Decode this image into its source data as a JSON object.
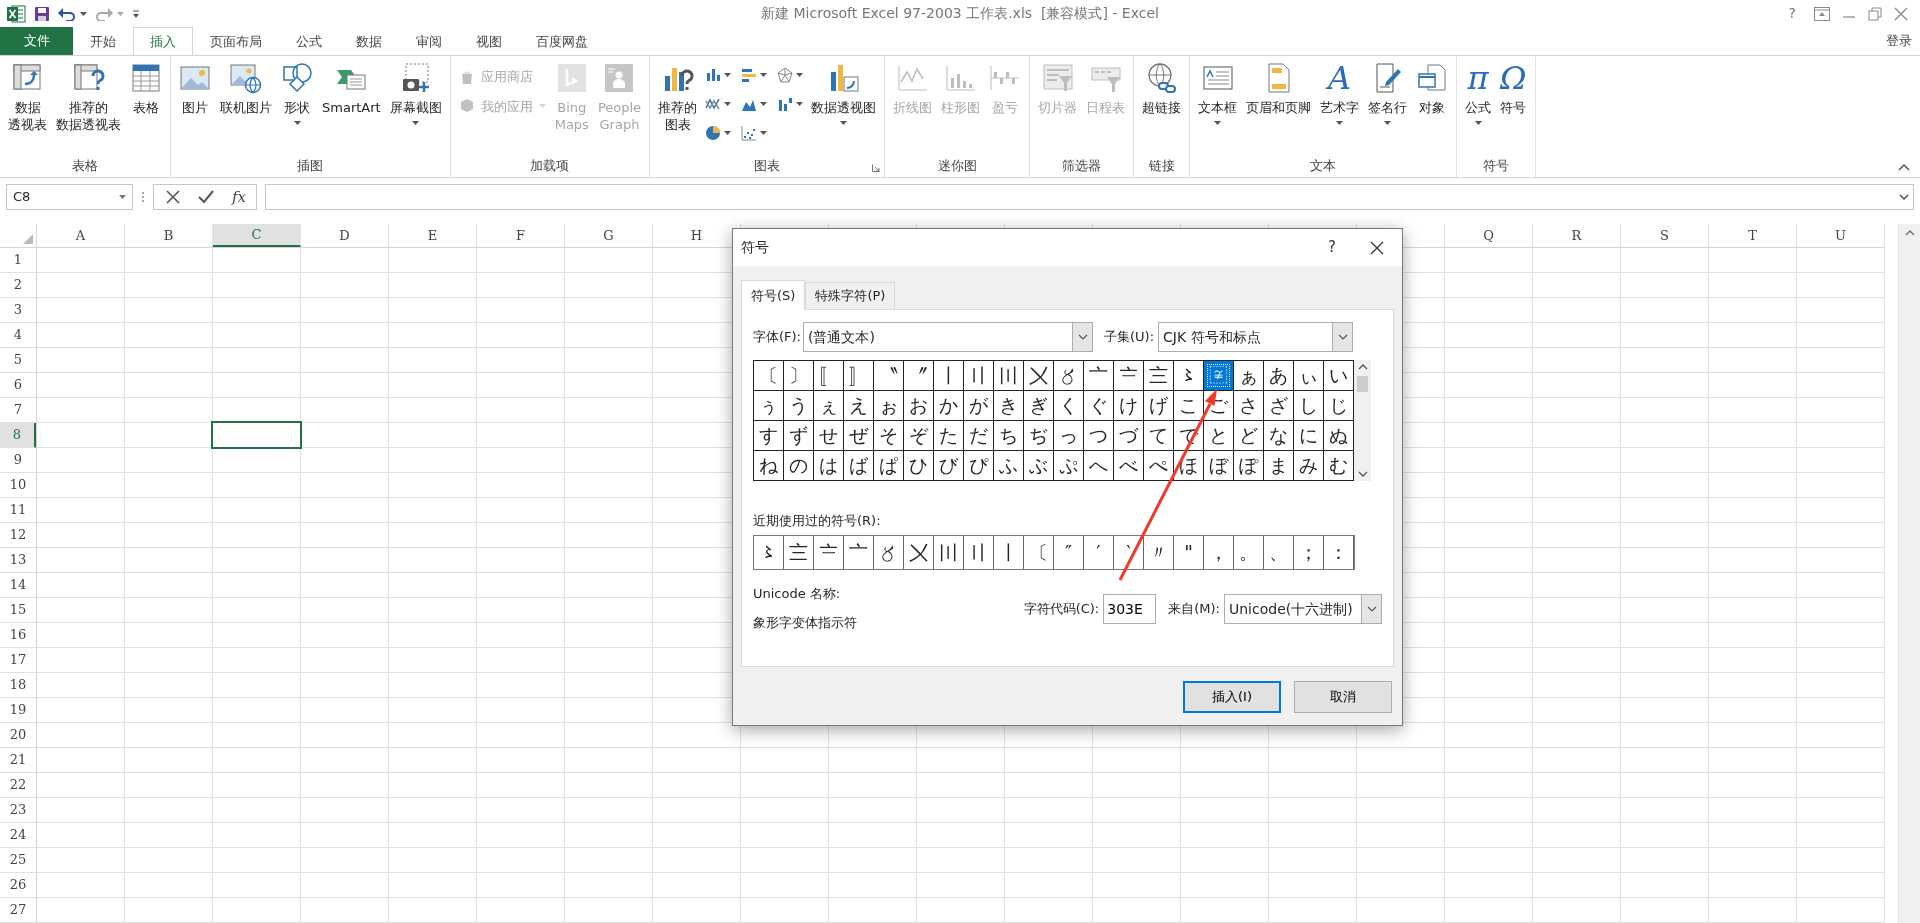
{
  "title_bar": {
    "title": "新建 Microsoft Excel 97-2003 工作表.xls  [兼容模式] - Excel",
    "help": "?"
  },
  "ribbon": {
    "tabs": [
      {
        "label": "文件",
        "kind": "file",
        "selected": false
      },
      {
        "label": "开始",
        "kind": "tab",
        "selected": false
      },
      {
        "label": "插入",
        "kind": "tab",
        "selected": true
      },
      {
        "label": "页面布局",
        "kind": "tab",
        "selected": false
      },
      {
        "label": "公式",
        "kind": "tab",
        "selected": false
      },
      {
        "label": "数据",
        "kind": "tab",
        "selected": false
      },
      {
        "label": "审阅",
        "kind": "tab",
        "selected": false
      },
      {
        "label": "视图",
        "kind": "tab",
        "selected": false
      },
      {
        "label": "百度网盘",
        "kind": "tab",
        "selected": false
      }
    ],
    "sign_in": "登录",
    "groups": [
      {
        "label": "表格",
        "launcher": false,
        "commands": [
          {
            "kind": "large",
            "lines": [
              "数据",
              "透视表"
            ],
            "dropdown": false,
            "disabled": false
          },
          {
            "kind": "large",
            "lines": [
              "推荐的",
              "数据透视表"
            ],
            "dropdown": false,
            "disabled": false
          },
          {
            "kind": "large",
            "lines": [
              "表格"
            ],
            "dropdown": false,
            "disabled": false
          }
        ]
      },
      {
        "label": "插图",
        "launcher": false,
        "commands": [
          {
            "kind": "large",
            "lines": [
              "图片"
            ],
            "dropdown": false,
            "disabled": false
          },
          {
            "kind": "large",
            "lines": [
              "联机图片"
            ],
            "dropdown": false,
            "disabled": false
          },
          {
            "kind": "large",
            "lines": [
              "形状"
            ],
            "dropdown": true,
            "disabled": false
          },
          {
            "kind": "large",
            "lines": [
              "SmartArt"
            ],
            "dropdown": false,
            "disabled": false
          },
          {
            "kind": "large",
            "lines": [
              "屏幕截图"
            ],
            "dropdown": true,
            "disabled": false
          }
        ]
      },
      {
        "label": "加载项",
        "launcher": false,
        "commands": [
          {
            "kind": "small",
            "lines": [
              "应用商店"
            ],
            "dropdown": false,
            "disabled": true
          },
          {
            "kind": "small",
            "lines": [
              "我的应用"
            ],
            "dropdown": true,
            "disabled": true
          },
          {
            "kind": "large",
            "lines": [
              "Bing",
              "Maps"
            ],
            "dropdown": false,
            "disabled": true
          },
          {
            "kind": "large",
            "lines": [
              "People",
              "Graph"
            ],
            "dropdown": false,
            "disabled": true
          }
        ]
      },
      {
        "label": "图表",
        "launcher": true,
        "commands": [
          {
            "kind": "large",
            "lines": [
              "推荐的",
              "图表"
            ],
            "dropdown": false,
            "disabled": false
          },
          {
            "kind": "chart-gallery"
          },
          {
            "kind": "large",
            "lines": [
              "数据透视图"
            ],
            "dropdown": true,
            "disabled": false
          }
        ]
      },
      {
        "label": "迷你图",
        "launcher": false,
        "commands": [
          {
            "kind": "large",
            "lines": [
              "折线图"
            ],
            "dropdown": false,
            "disabled": true
          },
          {
            "kind": "large",
            "lines": [
              "柱形图"
            ],
            "dropdown": false,
            "disabled": true
          },
          {
            "kind": "large",
            "lines": [
              "盈亏"
            ],
            "dropdown": false,
            "disabled": true
          }
        ]
      },
      {
        "label": "筛选器",
        "launcher": false,
        "commands": [
          {
            "kind": "large",
            "lines": [
              "切片器"
            ],
            "dropdown": false,
            "disabled": true
          },
          {
            "kind": "large",
            "lines": [
              "日程表"
            ],
            "dropdown": false,
            "disabled": true
          }
        ]
      },
      {
        "label": "链接",
        "launcher": false,
        "commands": [
          {
            "kind": "large",
            "lines": [
              "超链接"
            ],
            "dropdown": false,
            "disabled": false
          }
        ]
      },
      {
        "label": "文本",
        "launcher": false,
        "commands": [
          {
            "kind": "large",
            "lines": [
              "文本框"
            ],
            "dropdown": true,
            "disabled": false
          },
          {
            "kind": "large",
            "lines": [
              "页眉和页脚"
            ],
            "dropdown": false,
            "disabled": false
          },
          {
            "kind": "glyph",
            "glyph": "A",
            "lines": [
              "艺术字"
            ],
            "dropdown": true,
            "disabled": false
          },
          {
            "kind": "large",
            "lines": [
              "签名行"
            ],
            "dropdown": true,
            "disabled": false
          },
          {
            "kind": "large",
            "lines": [
              "对象"
            ],
            "dropdown": false,
            "disabled": false
          }
        ]
      },
      {
        "label": "符号",
        "launcher": false,
        "commands": [
          {
            "kind": "glyph",
            "glyph": "π",
            "lines": [
              "公式"
            ],
            "dropdown": true,
            "disabled": false
          },
          {
            "kind": "glyph",
            "glyph": "Ω",
            "lines": [
              "符号"
            ],
            "dropdown": false,
            "disabled": false
          }
        ]
      }
    ]
  },
  "formula_bar": {
    "name_box": "C8",
    "function_label": "fx"
  },
  "sheet": {
    "columns_left": [
      {
        "label": "A",
        "selected": false
      },
      {
        "label": "B",
        "selected": false
      },
      {
        "label": "C",
        "selected": true
      },
      {
        "label": "D",
        "selected": false
      },
      {
        "label": "E",
        "selected": false
      },
      {
        "label": "F",
        "selected": false
      },
      {
        "label": "G",
        "selected": false
      },
      {
        "label": "H",
        "selected": false
      }
    ],
    "columns_right": [
      {
        "label": "Q",
        "selected": false
      },
      {
        "label": "R",
        "selected": false
      },
      {
        "label": "S",
        "selected": false
      },
      {
        "label": "T",
        "selected": false
      },
      {
        "label": "U",
        "selected": false
      }
    ],
    "rows": [
      {
        "label": "1",
        "selected": false
      },
      {
        "label": "2",
        "selected": false
      },
      {
        "label": "3",
        "selected": false
      },
      {
        "label": "4",
        "selected": false
      },
      {
        "label": "5",
        "selected": false
      },
      {
        "label": "6",
        "selected": false
      },
      {
        "label": "7",
        "selected": false
      },
      {
        "label": "8",
        "selected": true
      },
      {
        "label": "9",
        "selected": false
      },
      {
        "label": "10",
        "selected": false
      },
      {
        "label": "11",
        "selected": false
      },
      {
        "label": "12",
        "selected": false
      },
      {
        "label": "13",
        "selected": false
      },
      {
        "label": "14",
        "selected": false
      },
      {
        "label": "15",
        "selected": false
      },
      {
        "label": "16",
        "selected": false
      },
      {
        "label": "17",
        "selected": false
      },
      {
        "label": "18",
        "selected": false
      },
      {
        "label": "19",
        "selected": false
      },
      {
        "label": "20",
        "selected": false
      },
      {
        "label": "21",
        "selected": false
      },
      {
        "label": "22",
        "selected": false
      },
      {
        "label": "23",
        "selected": false
      },
      {
        "label": "24",
        "selected": false
      },
      {
        "label": "25",
        "selected": false
      },
      {
        "label": "26",
        "selected": false
      },
      {
        "label": "27",
        "selected": false
      }
    ]
  },
  "dialog": {
    "title": "符号",
    "help": "?",
    "tabs": [
      {
        "label": "符号(S)",
        "selected": true
      },
      {
        "label": "特殊字符(P)",
        "selected": false
      }
    ],
    "font_label": "字体(F):",
    "font_value": "(普通文本)",
    "subset_label": "子集(U):",
    "subset_value": "CJK 符号和标点",
    "symbol_rows": [
      {
        "cells": [
          {
            "char": "〔",
            "selected": false
          },
          {
            "char": "〕",
            "selected": false
          },
          {
            "char": "〚",
            "selected": false
          },
          {
            "char": "〛",
            "selected": false
          },
          {
            "char": "〝",
            "selected": false
          },
          {
            "char": "〞",
            "selected": false
          },
          {
            "char": "〡",
            "selected": false
          },
          {
            "char": "〢",
            "selected": false
          },
          {
            "char": "〣",
            "selected": false
          },
          {
            "char": "〤",
            "selected": false
          },
          {
            "char": "〥",
            "selected": false
          },
          {
            "char": "〦",
            "selected": false
          },
          {
            "char": "〧",
            "selected": false
          },
          {
            "char": "〨",
            "selected": false
          },
          {
            "char": "〻",
            "selected": false
          },
          {
            "char": "〾",
            "selected": true
          },
          {
            "char": "ぁ",
            "selected": false
          },
          {
            "char": "あ",
            "selected": false
          },
          {
            "char": "ぃ",
            "selected": false
          },
          {
            "char": "い",
            "selected": false
          }
        ]
      },
      {
        "cells": [
          {
            "char": "ぅ",
            "selected": false
          },
          {
            "char": "う",
            "selected": false
          },
          {
            "char": "ぇ",
            "selected": false
          },
          {
            "char": "え",
            "selected": false
          },
          {
            "char": "ぉ",
            "selected": false
          },
          {
            "char": "お",
            "selected": false
          },
          {
            "char": "か",
            "selected": false
          },
          {
            "char": "が",
            "selected": false
          },
          {
            "char": "き",
            "selected": false
          },
          {
            "char": "ぎ",
            "selected": false
          },
          {
            "char": "く",
            "selected": false
          },
          {
            "char": "ぐ",
            "selected": false
          },
          {
            "char": "け",
            "selected": false
          },
          {
            "char": "げ",
            "selected": false
          },
          {
            "char": "こ",
            "selected": false
          },
          {
            "char": "ご",
            "selected": false
          },
          {
            "char": "さ",
            "selected": false
          },
          {
            "char": "ざ",
            "selected": false
          },
          {
            "char": "し",
            "selected": false
          },
          {
            "char": "じ",
            "selected": false
          }
        ]
      },
      {
        "cells": [
          {
            "char": "す",
            "selected": false
          },
          {
            "char": "ず",
            "selected": false
          },
          {
            "char": "せ",
            "selected": false
          },
          {
            "char": "ぜ",
            "selected": false
          },
          {
            "char": "そ",
            "selected": false
          },
          {
            "char": "ぞ",
            "selected": false
          },
          {
            "char": "た",
            "selected": false
          },
          {
            "char": "だ",
            "selected": false
          },
          {
            "char": "ち",
            "selected": false
          },
          {
            "char": "ぢ",
            "selected": false
          },
          {
            "char": "っ",
            "selected": false
          },
          {
            "char": "つ",
            "selected": false
          },
          {
            "char": "づ",
            "selected": false
          },
          {
            "char": "て",
            "selected": false
          },
          {
            "char": "で",
            "selected": false
          },
          {
            "char": "と",
            "selected": false
          },
          {
            "char": "ど",
            "selected": false
          },
          {
            "char": "な",
            "selected": false
          },
          {
            "char": "に",
            "selected": false
          },
          {
            "char": "ぬ",
            "selected": false
          }
        ]
      },
      {
        "cells": [
          {
            "char": "ね",
            "selected": false
          },
          {
            "char": "の",
            "selected": false
          },
          {
            "char": "は",
            "selected": false
          },
          {
            "char": "ば",
            "selected": false
          },
          {
            "char": "ぱ",
            "selected": false
          },
          {
            "char": "ひ",
            "selected": false
          },
          {
            "char": "び",
            "selected": false
          },
          {
            "char": "ぴ",
            "selected": false
          },
          {
            "char": "ふ",
            "selected": false
          },
          {
            "char": "ぶ",
            "selected": false
          },
          {
            "char": "ぷ",
            "selected": false
          },
          {
            "char": "へ",
            "selected": false
          },
          {
            "char": "べ",
            "selected": false
          },
          {
            "char": "ぺ",
            "selected": false
          },
          {
            "char": "ほ",
            "selected": false
          },
          {
            "char": "ぼ",
            "selected": false
          },
          {
            "char": "ぽ",
            "selected": false
          },
          {
            "char": "ま",
            "selected": false
          },
          {
            "char": "み",
            "selected": false
          },
          {
            "char": "む",
            "selected": false
          }
        ]
      }
    ],
    "recent_label": "近期使用过的符号(R):",
    "recent": [
      "〻",
      "〨",
      "〧",
      "〦",
      "〥",
      "〤",
      "〣",
      "〢",
      "〡",
      "〔",
      "″",
      "′",
      "‵",
      "〃",
      "\"",
      "，",
      "。",
      "、",
      "；",
      "："
    ],
    "unicode_name_label": "Unicode 名称:",
    "unicode_name": "象形字变体指示符",
    "code_label": "字符代码(C):",
    "code_value": "303E",
    "from_label": "来自(M):",
    "from_value": "Unicode(十六进制)",
    "buttons": [
      {
        "label": "插入(I)",
        "kind": "primary"
      },
      {
        "label": "取消",
        "kind": "secondary"
      }
    ]
  }
}
